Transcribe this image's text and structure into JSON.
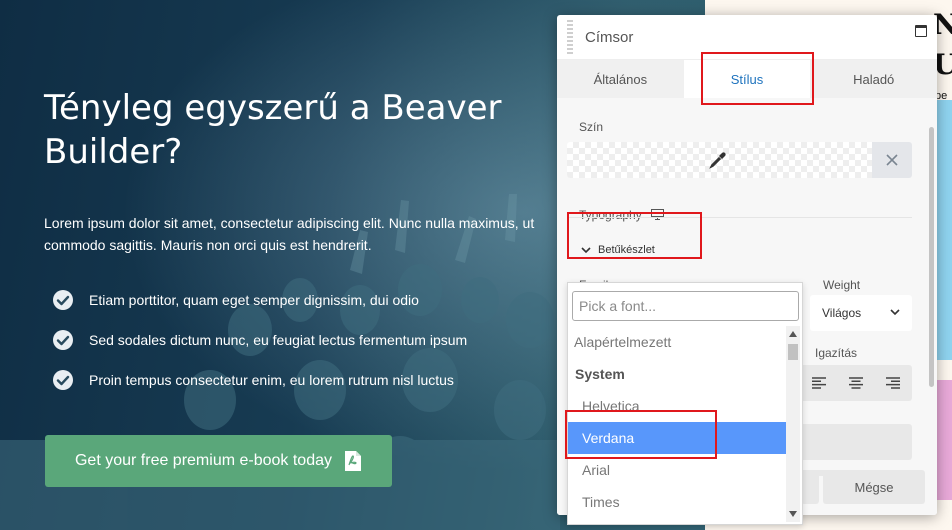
{
  "hero": {
    "heading": "Tényleg egyszerű a Beaver Builder?",
    "paragraph": "Lorem ipsum dolor sit amet, consectetur adipiscing elit. Nunc nulla maximus, ut commodo sagittis. Mauris non orci quis est hendrerit.",
    "features": [
      "Etiam porttitor, quam eget semper dignissim, dui odio",
      "Sed sodales dictum nunc, eu feugiat lectus fermentum ipsum",
      "Proin tempus consectetur enim, eu lorem  rutrum nisl luctus"
    ],
    "cta_label": "Get your free premium e-book today",
    "cta_color": "#5aa77a"
  },
  "page_fragments": [
    "No",
    "UI",
    "pe"
  ],
  "panel": {
    "title": "Címsor",
    "tabs": [
      {
        "label": "Általános",
        "active": false
      },
      {
        "label": "Stílus",
        "active": true
      },
      {
        "label": "Haladó",
        "active": false
      }
    ],
    "color_label": "Szín",
    "typography_label": "Typography",
    "section_label": "Betűkészlet",
    "family_label": "Family",
    "weight_label": "Weight",
    "weight_value": "Világos",
    "align_label": "Igazítás",
    "cancel_label": "Mégse",
    "accent_color": "#1e73be"
  },
  "font_dropdown": {
    "placeholder": "Pick a font...",
    "default_option": "Alapértelmezett",
    "group_label": "System",
    "options": [
      "Helvetica",
      "Verdana",
      "Arial",
      "Times"
    ],
    "selected": "Verdana",
    "selected_color": "#5897fb"
  },
  "highlight_color": "#e0181c"
}
